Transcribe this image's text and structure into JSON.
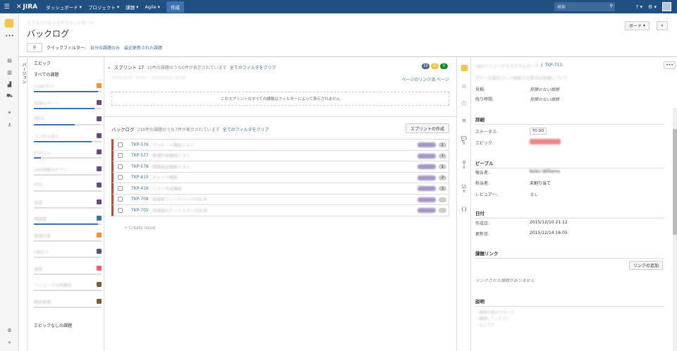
{
  "topbar": {
    "logo": "JIRA",
    "nav": [
      {
        "label": "ダッシュボード"
      },
      {
        "label": "プロジェクト"
      },
      {
        "label": "課題"
      },
      {
        "label": "Agile"
      }
    ],
    "create": "作成",
    "search_placeholder": "検索",
    "colors": {
      "bar": "#205081",
      "create": "#3b73af"
    }
  },
  "header": {
    "breadcrumb": "エクスペリエンスグラウンドボード",
    "title": "バックログ",
    "quick_filter_label": "クイックフィルター:",
    "filters": [
      "自分の課題のみ",
      "最近更新された課題"
    ],
    "board_btn": "ボード",
    "collapse_btn": "«"
  },
  "epics": {
    "tab_label": "バージョン",
    "title": "エピック",
    "all_issues": "すべての課題",
    "items": [
      {
        "name": "CUATラバ",
        "color": "#f79232",
        "progress": 0.95
      },
      {
        "name": "共通ルギーリ",
        "color": "#654982",
        "progress": 0.9
      },
      {
        "name": "NEOL",
        "color": "#654982",
        "progress": 0.6
      },
      {
        "name": "デジタル自分",
        "color": "#654982",
        "progress": 0.85
      },
      {
        "name": "ログイン",
        "color": "#654982",
        "progress": 0.1
      },
      {
        "name": "SAS移動ログイン",
        "color": "#654982",
        "progress": 0
      },
      {
        "name": "ERO",
        "color": "#654982",
        "progress": 0
      },
      {
        "name": "決済",
        "color": "#654982",
        "progress": 0
      },
      {
        "name": "情報整",
        "color": "#3b73af",
        "progress": 0.95
      },
      {
        "name": "管理作業",
        "color": "#f79232",
        "progress": 0
      },
      {
        "name": "F地方人",
        "color": "#654982",
        "progress": 0
      },
      {
        "name": "運用",
        "color": "#f15c75",
        "progress": 0
      },
      {
        "name": "リニューアル作業外",
        "color": "#815b3a",
        "progress": 0
      },
      {
        "name": "関係者様",
        "color": "#815b3a",
        "progress": 0
      }
    ],
    "no_epic": "エピックなしの課題"
  },
  "sprint": {
    "name": "スプリント 17",
    "info": "10件の課題のうち0件が表示されています",
    "clear": "全てのフィルタをクリア",
    "badges": [
      {
        "value": "10",
        "color": "#4a6785"
      },
      {
        "value": "0",
        "color": "#f6c342"
      },
      {
        "value": "0",
        "color": "#14892c"
      }
    ],
    "dates": "2015/12/07 10:00 • 2015/12/21 10:00",
    "page_link": "ページのリンク済 ページ",
    "empty_message": "このスプリントのすべての課題はフィルターによって表示されません"
  },
  "backlog": {
    "title": "バックログ",
    "info": "218件の課題のうち7件が表示されています",
    "clear": "全てのフィルタをクリア",
    "create_sprint": "スプリントの作成",
    "issues": [
      {
        "key": "TKP-576",
        "summary": "アンケート機能テスト",
        "estimate": "1"
      },
      {
        "key": "TKP-577",
        "summary": "新規作成機能テスト",
        "estimate": "1"
      },
      {
        "key": "TKP-578",
        "summary": "問題設定機能テスト",
        "estimate": "1"
      },
      {
        "key": "TKP-415",
        "summary": "チャット機能",
        "estimate": "2"
      },
      {
        "key": "TKP-416",
        "summary": "リスト作成機能",
        "estimate": "3"
      },
      {
        "key": "TKP-709",
        "summary": "地域版フィードバック対応済",
        "estimate": ""
      },
      {
        "key": "TKP-705",
        "summary": "地域版ロケットスター対応済",
        "estimate": ""
      }
    ],
    "create_issue": "+ Create issue"
  },
  "detail": {
    "breadcrumb_project": "GBXリニューアルスクラムボード",
    "key": "TKP-713",
    "summary": "ダディ社案内プレイ画面での表示の改善について",
    "fields": [
      {
        "label": "見積:",
        "value": "見積のない課題"
      },
      {
        "label": "残り時間:",
        "value": "見積のない課題"
      }
    ],
    "details_title": "詳細",
    "status_label": "ステータス:",
    "status": "TO DO",
    "epic_label": "エピック:",
    "people_title": "ピープル",
    "reporter_label": "報告者:",
    "reporter": "Keiko Williams",
    "assignee_label": "担当者:",
    "assignee": "未割り当て",
    "reviewer_label": "レビュアー:",
    "reviewer": "なし",
    "dates_title": "日付",
    "created_label": "作成日:",
    "created": "2015/12/10 21:12",
    "updated_label": "更新日:",
    "updated": "2015/12/14 16:05",
    "links_title": "課題リンク",
    "add_link": "リンクの追加",
    "no_links": "リンクされた課題がありません",
    "desc_title": "説明",
    "desc_lines": [
      "・画面の表示スタイル",
      "・確認してください",
      "・以上です"
    ],
    "icon_counts": [
      "0",
      "0",
      "0"
    ]
  }
}
